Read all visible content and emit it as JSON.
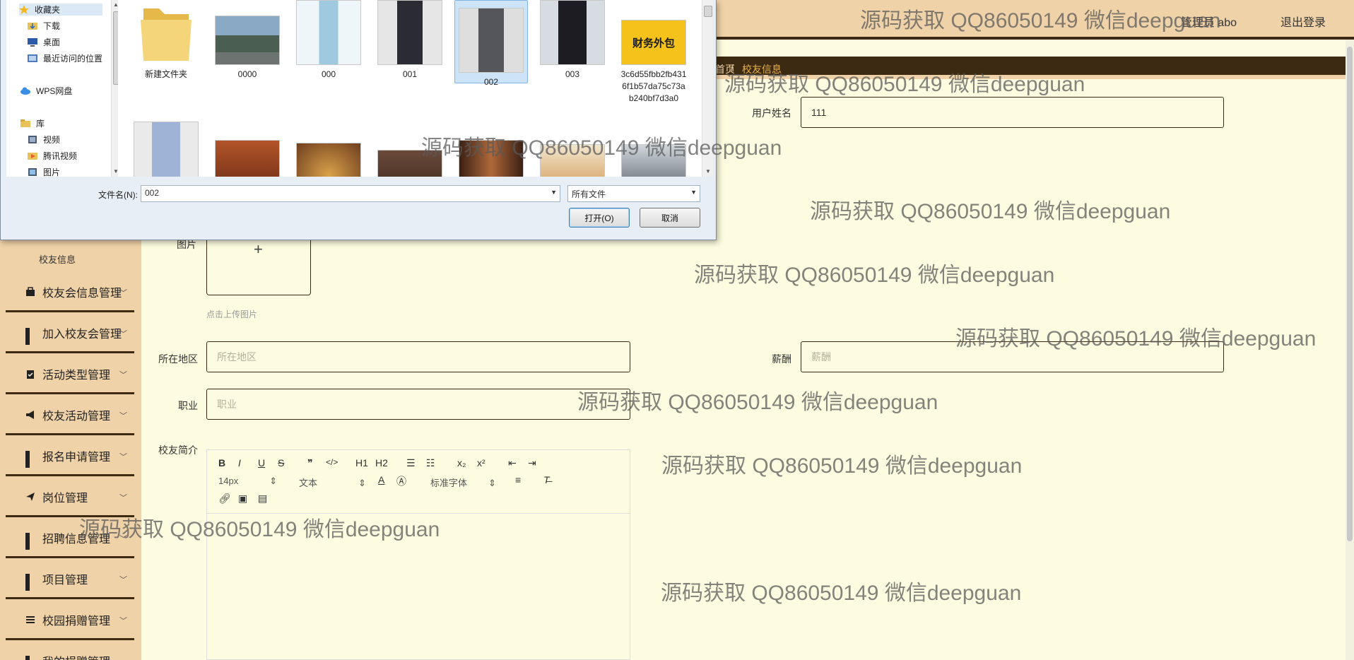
{
  "header": {
    "user_label": "管理员 abo",
    "logout_label": "退出登录"
  },
  "breadcrumb": {
    "home": "首页",
    "separator": "/",
    "current": "校友信息"
  },
  "sidebar": {
    "section": "校友信息",
    "items": [
      {
        "label": "校友会信息管理",
        "icon": "briefcase-icon"
      },
      {
        "label": "加入校友会管理",
        "icon": "grid-icon"
      },
      {
        "label": "活动类型管理",
        "icon": "clipboard-icon"
      },
      {
        "label": "校友活动管理",
        "icon": "megaphone-icon"
      },
      {
        "label": "报名申请管理",
        "icon": "grid-icon"
      },
      {
        "label": "岗位管理",
        "icon": "send-icon"
      },
      {
        "label": "招聘信息管理",
        "icon": "grid-icon"
      },
      {
        "label": "项目管理",
        "icon": "grid-icon"
      },
      {
        "label": "校园捐赠管理",
        "icon": "list-icon"
      },
      {
        "label": "我的捐赠管理",
        "icon": "grid-icon"
      }
    ]
  },
  "form": {
    "username": {
      "label": "用户姓名",
      "value": "111"
    },
    "photo": {
      "label": "图片",
      "hint": "点击上传图片"
    },
    "region": {
      "label": "所在地区",
      "placeholder": "所在地区"
    },
    "salary": {
      "label": "薪酬",
      "placeholder": "薪酬"
    },
    "job": {
      "label": "职业",
      "placeholder": "职业"
    },
    "intro": {
      "label": "校友简介"
    }
  },
  "editor": {
    "font_size": "14px",
    "text_type": "文本",
    "font_family": "标准字体",
    "buttons": [
      "B",
      "I",
      "U",
      "S",
      "❞",
      "</>",
      "H1",
      "H2"
    ]
  },
  "dialog": {
    "nav": [
      {
        "label": "收藏夹",
        "icon": "star-icon"
      },
      {
        "label": "下载",
        "icon": "download-folder-icon"
      },
      {
        "label": "桌面",
        "icon": "desktop-icon"
      },
      {
        "label": "最近访问的位置",
        "icon": "recent-icon"
      },
      {
        "label": "WPS网盘",
        "icon": "cloud-icon"
      },
      {
        "label": "库",
        "icon": "library-icon"
      },
      {
        "label": "视频",
        "icon": "video-icon"
      },
      {
        "label": "腾讯视频",
        "icon": "tencent-video-icon"
      },
      {
        "label": "图片",
        "icon": "pictures-icon"
      }
    ],
    "files": [
      {
        "name": "新建文件夹",
        "kind": "folder"
      },
      {
        "name": "0000",
        "kind": "image"
      },
      {
        "name": "000",
        "kind": "image"
      },
      {
        "name": "001",
        "kind": "image"
      },
      {
        "name": "002",
        "kind": "image",
        "selected": true
      },
      {
        "name": "003",
        "kind": "image"
      },
      {
        "name": "3c6d55fbb2fb4316f1b57da75c73ab240bf7d3a0",
        "kind": "image"
      }
    ],
    "filename_label": "文件名(N):",
    "filename_value": "002",
    "filetype": "所有文件",
    "open_label": "打开(O)",
    "cancel_label": "取消",
    "thumb_text": "财务外包"
  },
  "watermark": "源码获取 QQ86050149 微信deepguan"
}
